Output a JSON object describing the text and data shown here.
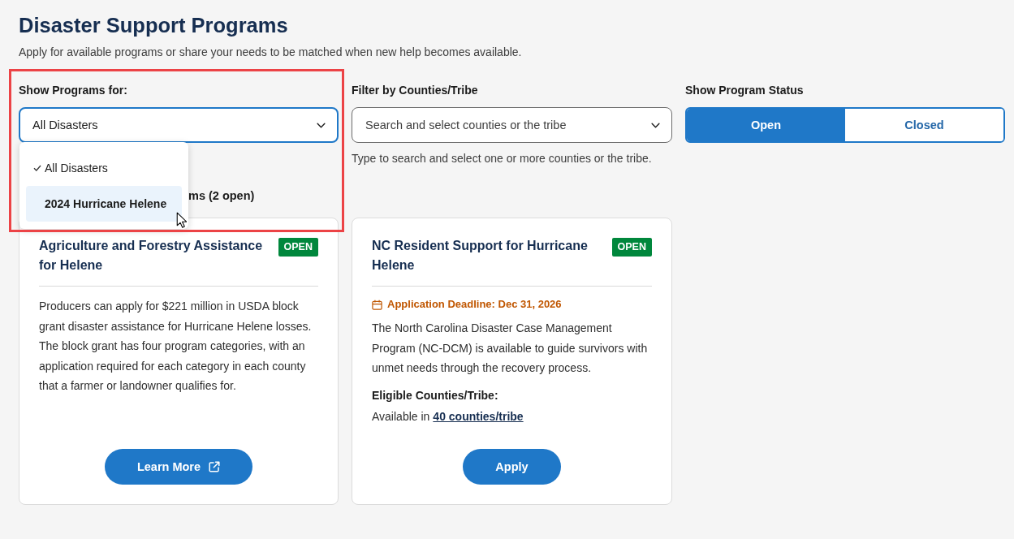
{
  "page": {
    "title": "Disaster Support Programs",
    "subtitle": "Apply for available programs or share your needs to be matched when new help becomes available."
  },
  "filters": {
    "programs": {
      "label": "Show Programs for:",
      "value": "All Disasters",
      "focused": true,
      "highlighted": true,
      "menu": [
        {
          "label": "All Disasters",
          "selected": true,
          "hovered": false
        },
        {
          "label": "2024 Hurricane Helene",
          "selected": false,
          "hovered": true
        }
      ]
    },
    "counties": {
      "label": "Filter by Counties/Tribe",
      "placeholder": "Search and select counties or the tribe",
      "focused": false,
      "hint": "Type to search and select one or more counties or the tribe."
    },
    "status": {
      "label": "Show Program Status",
      "options": [
        {
          "label": "Open",
          "selected": true
        },
        {
          "label": "Closed",
          "selected": false
        }
      ]
    }
  },
  "results_count": "ms (2 open)",
  "programs": [
    {
      "title": "Agriculture and Forestry Assistance for Helene",
      "badge": "OPEN",
      "description": "Producers can apply for $221 million in USDA block grant disaster assistance for Hurricane Helene losses. The block grant has four program categories, with an application required for each category in each county that a farmer or landowner qualifies for.",
      "action": {
        "label": "Learn More",
        "external": true
      }
    },
    {
      "title": "NC Resident Support for Hurricane Helene",
      "badge": "OPEN",
      "deadline": "Application Deadline: Dec 31, 2026",
      "description": "The North Carolina Disaster Case Management Program (NC-DCM) is available to guide survivors with unmet needs through the recovery process.",
      "eligibility": {
        "heading": "Eligible Counties/Tribe:",
        "prefix": "Available in",
        "link": "40 counties/tribe"
      },
      "action": {
        "label": "Apply",
        "external": false
      }
    }
  ]
}
